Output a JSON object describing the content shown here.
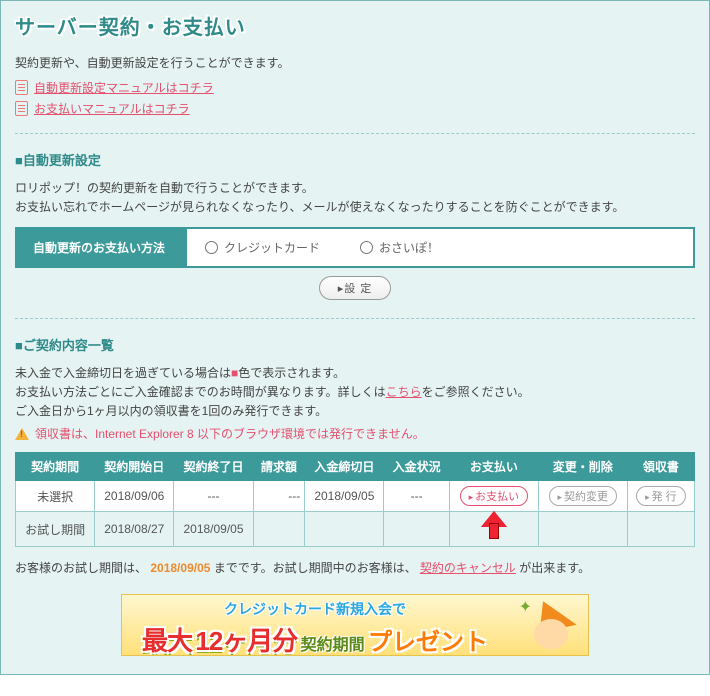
{
  "page": {
    "title": "サーバー契約・お支払い",
    "intro": "契約更新や、自動更新設定を行うことができます。",
    "manual_links": [
      "自動更新設定マニュアルはコチラ",
      "お支払いマニュアルはコチラ"
    ]
  },
  "auto_renew": {
    "heading": "■自動更新設定",
    "desc1": "ロリポップ！の契約更新を自動で行うことができます。",
    "desc2": "お支払い忘れでホームページが見られなくなったり、メールが使えなくなったりすることを防ぐことができます。",
    "row_label": "自動更新のお支払い方法",
    "option_credit": "クレジットカード",
    "option_osaipo": "おさいぽ！",
    "submit_label": "▸設 定"
  },
  "contracts": {
    "heading": "■ご契約内容一覧",
    "note1_pre": "未入金で入金締切日を過ぎている場合は",
    "note1_post": "色で表示されます。",
    "note2_pre": "お支払い方法ごとにご入金確認までのお時間が異なります。詳しくは",
    "note2_link": "こちら",
    "note2_post": "をご参照ください。",
    "note3": "ご入金日から1ヶ月以内の領収書を1回のみ発行できます。",
    "warn": "領収書は、Internet Explorer 8 以下のブラウザ環境では発行できません。",
    "columns": [
      "契約期間",
      "契約開始日",
      "契約終了日",
      "請求額",
      "入金締切日",
      "入金状況",
      "お支払い",
      "変更・削除",
      "領収書"
    ],
    "rows": [
      {
        "period": "未選択",
        "start": "2018/09/06",
        "end": "---",
        "amount": "---",
        "due": "2018/09/05",
        "status": "---",
        "pay_btn": "お支払い",
        "change_btn": "契約変更",
        "receipt_btn": "発 行"
      },
      {
        "period": "お試し期間",
        "start": "2018/08/27",
        "end": "2018/09/05",
        "amount": "",
        "due": "",
        "status": "",
        "pay_btn": "",
        "change_btn": "",
        "receipt_btn": ""
      }
    ],
    "footer_pre": "お客様のお試し期間は、",
    "footer_date": "2018/09/05",
    "footer_mid": " までです。お試し期間中のお客様は、",
    "footer_link": "契約のキャンセル",
    "footer_post": "が出来ます。"
  },
  "banner": {
    "line1": "クレジットカード新規入会で",
    "big1": "最大",
    "big2": "12ヶ月分",
    "mid": "契約期間",
    "big3": "プレゼント"
  }
}
